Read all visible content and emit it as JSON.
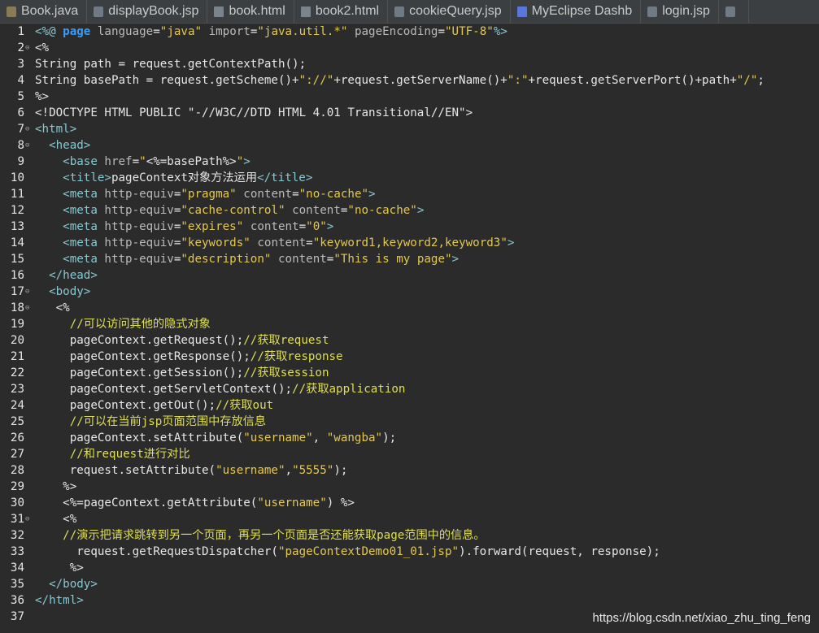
{
  "tabs": [
    {
      "label": "Book.java",
      "icon": "java-file-icon",
      "cls": "ic-java"
    },
    {
      "label": "displayBook.jsp",
      "icon": "jsp-file-icon",
      "cls": "ic-jsp"
    },
    {
      "label": "book.html",
      "icon": "html-file-icon",
      "cls": "ic-html"
    },
    {
      "label": "book2.html",
      "icon": "html-file-icon",
      "cls": "ic-html"
    },
    {
      "label": "cookieQuery.jsp",
      "icon": "jsp-file-icon",
      "cls": "ic-jsp"
    },
    {
      "label": "MyEclipse Dashb",
      "icon": "dashboard-icon",
      "cls": "ic-dash"
    },
    {
      "label": "login.jsp",
      "icon": "jsp-file-icon",
      "cls": "ic-jsp"
    },
    {
      "label": "",
      "icon": "file-icon",
      "cls": "ic-jsp"
    }
  ],
  "lines": [
    {
      "n": "1",
      "fold": false,
      "segs": [
        [
          "t",
          "<"
        ],
        [
          "t",
          "%@ "
        ],
        [
          "k",
          "page "
        ],
        [
          "a",
          "language"
        ],
        [
          "",
          "="
        ],
        [
          "s",
          "\"java\""
        ],
        [
          "",
          " "
        ],
        [
          "a",
          "import"
        ],
        [
          "",
          "="
        ],
        [
          "s",
          "\"java.util.*\""
        ],
        [
          "",
          " "
        ],
        [
          "a",
          "pageEncoding"
        ],
        [
          "",
          "="
        ],
        [
          "s",
          "\"UTF-8\""
        ],
        [
          "t",
          "%>"
        ]
      ]
    },
    {
      "n": "2",
      "fold": true,
      "segs": [
        [
          "",
          "<%"
        ]
      ]
    },
    {
      "n": "3",
      "fold": false,
      "segs": [
        [
          "",
          "String path = request.getContextPath();"
        ]
      ]
    },
    {
      "n": "4",
      "fold": false,
      "segs": [
        [
          "",
          "String basePath = request.getScheme()+"
        ],
        [
          "s",
          "\"://\""
        ],
        [
          "",
          "+request.getServerName()+"
        ],
        [
          "s",
          "\":\""
        ],
        [
          "",
          "+request.getServerPort()+path+"
        ],
        [
          "s",
          "\"/\""
        ],
        [
          "",
          ";"
        ]
      ]
    },
    {
      "n": "5",
      "fold": false,
      "segs": [
        [
          "",
          "%>"
        ]
      ]
    },
    {
      "n": "6",
      "fold": false,
      "segs": [
        [
          "",
          "<!DOCTYPE HTML PUBLIC \"-//W3C//DTD HTML 4.01 Transitional//EN\">"
        ]
      ]
    },
    {
      "n": "7",
      "fold": true,
      "segs": [
        [
          "t",
          "<html>"
        ]
      ]
    },
    {
      "n": "8",
      "fold": true,
      "segs": [
        [
          "t",
          "  <head>"
        ]
      ]
    },
    {
      "n": "9",
      "fold": false,
      "segs": [
        [
          "t",
          "    <base "
        ],
        [
          "a",
          "href"
        ],
        [
          "",
          "="
        ],
        [
          "s",
          "\""
        ],
        [
          "",
          "<%=basePath%>"
        ],
        [
          "s",
          "\""
        ],
        [
          "t",
          ">"
        ]
      ]
    },
    {
      "n": "10",
      "fold": false,
      "segs": [
        [
          "t",
          "    <title>"
        ],
        [
          "",
          "pageContext对象方法运用"
        ],
        [
          "t",
          "</title>"
        ]
      ]
    },
    {
      "n": "11",
      "fold": false,
      "segs": [
        [
          "t",
          "    <meta "
        ],
        [
          "a",
          "http-equiv"
        ],
        [
          "",
          "="
        ],
        [
          "s",
          "\"pragma\""
        ],
        [
          "",
          " "
        ],
        [
          "a",
          "content"
        ],
        [
          "",
          "="
        ],
        [
          "s",
          "\"no-cache\""
        ],
        [
          "t",
          ">"
        ]
      ]
    },
    {
      "n": "12",
      "fold": false,
      "segs": [
        [
          "t",
          "    <meta "
        ],
        [
          "a",
          "http-equiv"
        ],
        [
          "",
          "="
        ],
        [
          "s",
          "\"cache-control\""
        ],
        [
          "",
          " "
        ],
        [
          "a",
          "content"
        ],
        [
          "",
          "="
        ],
        [
          "s",
          "\"no-cache\""
        ],
        [
          "t",
          ">"
        ]
      ]
    },
    {
      "n": "13",
      "fold": false,
      "segs": [
        [
          "t",
          "    <meta "
        ],
        [
          "a",
          "http-equiv"
        ],
        [
          "",
          "="
        ],
        [
          "s",
          "\"expires\""
        ],
        [
          "",
          " "
        ],
        [
          "a",
          "content"
        ],
        [
          "",
          "="
        ],
        [
          "s",
          "\"0\""
        ],
        [
          "t",
          ">"
        ]
      ]
    },
    {
      "n": "14",
      "fold": false,
      "segs": [
        [
          "t",
          "    <meta "
        ],
        [
          "a",
          "http-equiv"
        ],
        [
          "",
          "="
        ],
        [
          "s",
          "\"keywords\""
        ],
        [
          "",
          " "
        ],
        [
          "a",
          "content"
        ],
        [
          "",
          "="
        ],
        [
          "s",
          "\"keyword1,keyword2,keyword3\""
        ],
        [
          "t",
          ">"
        ]
      ]
    },
    {
      "n": "15",
      "fold": false,
      "segs": [
        [
          "t",
          "    <meta "
        ],
        [
          "a",
          "http-equiv"
        ],
        [
          "",
          "="
        ],
        [
          "s",
          "\"description\""
        ],
        [
          "",
          " "
        ],
        [
          "a",
          "content"
        ],
        [
          "",
          "="
        ],
        [
          "s",
          "\"This is my page\""
        ],
        [
          "t",
          ">"
        ]
      ]
    },
    {
      "n": "16",
      "fold": false,
      "segs": [
        [
          "t",
          "  </head>"
        ]
      ]
    },
    {
      "n": "17",
      "fold": true,
      "segs": [
        [
          "t",
          "  <body>"
        ]
      ]
    },
    {
      "n": "18",
      "fold": true,
      "segs": [
        [
          "",
          "   <%"
        ]
      ]
    },
    {
      "n": "19",
      "fold": false,
      "segs": [
        [
          "c",
          "     //可以访问其他的隐式对象"
        ]
      ]
    },
    {
      "n": "20",
      "fold": false,
      "segs": [
        [
          "",
          "     pageContext.getRequest();"
        ],
        [
          "c",
          "//获取request"
        ]
      ]
    },
    {
      "n": "21",
      "fold": false,
      "segs": [
        [
          "",
          "     pageContext.getResponse();"
        ],
        [
          "c",
          "//获取response"
        ]
      ]
    },
    {
      "n": "22",
      "fold": false,
      "segs": [
        [
          "",
          "     pageContext.getSession();"
        ],
        [
          "c",
          "//获取session"
        ]
      ]
    },
    {
      "n": "23",
      "fold": false,
      "segs": [
        [
          "",
          "     pageContext.getServletContext();"
        ],
        [
          "c",
          "//获取application"
        ]
      ]
    },
    {
      "n": "24",
      "fold": false,
      "segs": [
        [
          "",
          "     pageContext.getOut();"
        ],
        [
          "c",
          "//获取out"
        ]
      ]
    },
    {
      "n": "25",
      "fold": false,
      "segs": [
        [
          "c",
          "     //可以在当前jsp页面范围中存放信息"
        ]
      ]
    },
    {
      "n": "26",
      "fold": false,
      "segs": [
        [
          "",
          "     pageContext.setAttribute("
        ],
        [
          "s",
          "\"username\""
        ],
        [
          "",
          ", "
        ],
        [
          "s",
          "\"wangba\""
        ],
        [
          "",
          ");"
        ]
      ]
    },
    {
      "n": "27",
      "fold": false,
      "segs": [
        [
          "c",
          "     //和request进行对比"
        ]
      ]
    },
    {
      "n": "28",
      "fold": false,
      "segs": [
        [
          "",
          "     request.setAttribute("
        ],
        [
          "s",
          "\"username\""
        ],
        [
          "",
          ","
        ],
        [
          "s",
          "\"5555\""
        ],
        [
          "",
          ");"
        ]
      ]
    },
    {
      "n": "29",
      "fold": false,
      "segs": [
        [
          "",
          "    %>"
        ]
      ]
    },
    {
      "n": "30",
      "fold": false,
      "segs": [
        [
          "",
          "    <%=pageContext.getAttribute("
        ],
        [
          "s",
          "\"username\""
        ],
        [
          "",
          ") %>"
        ]
      ]
    },
    {
      "n": "31",
      "fold": true,
      "segs": [
        [
          "",
          "    <%"
        ]
      ]
    },
    {
      "n": "32",
      "fold": false,
      "segs": [
        [
          "c",
          "    //演示把请求跳转到另一个页面，再另一个页面是否还能获取page范围中的信息。"
        ]
      ]
    },
    {
      "n": "33",
      "fold": false,
      "segs": [
        [
          "",
          "      request.getRequestDispatcher("
        ],
        [
          "s",
          "\"pageContextDemo01_01.jsp\""
        ],
        [
          "",
          ").forward(request, response);"
        ]
      ]
    },
    {
      "n": "34",
      "fold": false,
      "segs": [
        [
          "",
          "     %>"
        ]
      ]
    },
    {
      "n": "35",
      "fold": false,
      "segs": [
        [
          "t",
          "  </body>"
        ]
      ]
    },
    {
      "n": "36",
      "fold": false,
      "segs": [
        [
          "t",
          "</html>"
        ]
      ]
    },
    {
      "n": "37",
      "fold": false,
      "segs": []
    }
  ],
  "watermark": "https://blog.csdn.net/xiao_zhu_ting_feng",
  "colors": {
    "background": "#2b2b2b",
    "tag": "#87c8d2",
    "string": "#e4c84b",
    "comment": "#dfdf4f",
    "keyword": "#3c9df8"
  }
}
